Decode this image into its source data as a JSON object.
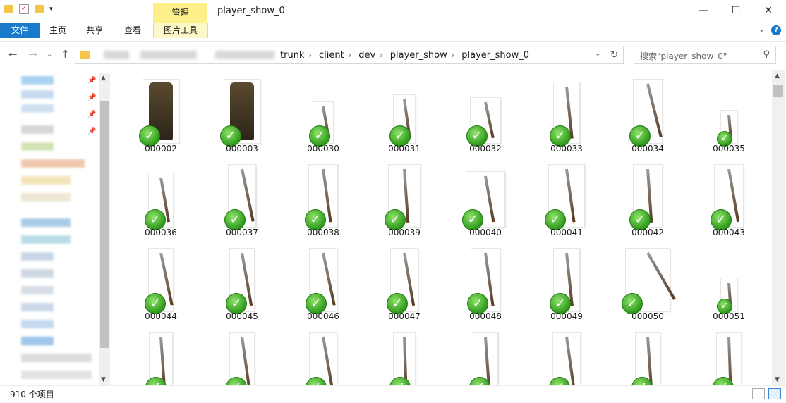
{
  "window": {
    "title": "player_show_0",
    "context_tab": "管理",
    "controls": [
      "—",
      "☐",
      "✕"
    ]
  },
  "ribbon": {
    "tabs": [
      "文件",
      "主页",
      "共享",
      "查看",
      "图片工具"
    ],
    "help": "?"
  },
  "address": {
    "crumbs": [
      "trunk",
      "client",
      "dev",
      "player_show",
      "player_show_0"
    ],
    "search_placeholder": "搜索\"player_show_0\""
  },
  "files": [
    {
      "name": "000002",
      "kind": "armor"
    },
    {
      "name": "000003",
      "kind": "armor"
    },
    {
      "name": "000030",
      "kind": "weapon"
    },
    {
      "name": "000031",
      "kind": "weapon"
    },
    {
      "name": "000032",
      "kind": "weapon"
    },
    {
      "name": "000033",
      "kind": "weapon"
    },
    {
      "name": "000034",
      "kind": "weapon"
    },
    {
      "name": "000035",
      "kind": "weapon"
    },
    {
      "name": "000036",
      "kind": "weapon"
    },
    {
      "name": "000037",
      "kind": "weapon"
    },
    {
      "name": "000038",
      "kind": "weapon"
    },
    {
      "name": "000039",
      "kind": "weapon"
    },
    {
      "name": "000040",
      "kind": "weapon"
    },
    {
      "name": "000041",
      "kind": "weapon"
    },
    {
      "name": "000042",
      "kind": "weapon"
    },
    {
      "name": "000043",
      "kind": "weapon"
    },
    {
      "name": "000044",
      "kind": "weapon"
    },
    {
      "name": "000045",
      "kind": "weapon"
    },
    {
      "name": "000046",
      "kind": "weapon"
    },
    {
      "name": "000047",
      "kind": "weapon"
    },
    {
      "name": "000048",
      "kind": "weapon"
    },
    {
      "name": "000049",
      "kind": "weapon"
    },
    {
      "name": "000050",
      "kind": "weapon"
    },
    {
      "name": "000051",
      "kind": "weapon"
    },
    {
      "name": "",
      "kind": "weapon"
    },
    {
      "name": "",
      "kind": "weapon"
    },
    {
      "name": "",
      "kind": "weapon"
    },
    {
      "name": "",
      "kind": "weapon"
    },
    {
      "name": "",
      "kind": "weapon"
    },
    {
      "name": "",
      "kind": "weapon"
    },
    {
      "name": "",
      "kind": "weapon"
    },
    {
      "name": "",
      "kind": "weapon"
    }
  ],
  "status": {
    "item_count": "910 个项目"
  },
  "colors": {
    "file_tab": "#1979ca",
    "context_tab": "#fdf08a",
    "sync_ok": "#2e9a1c"
  }
}
